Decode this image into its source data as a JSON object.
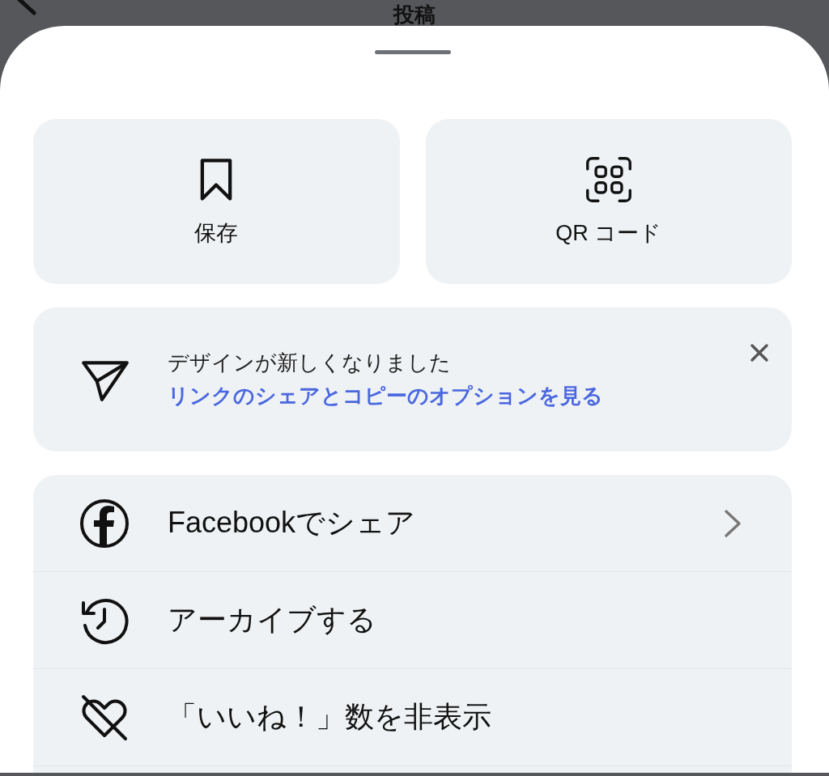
{
  "header": {
    "title": "投稿"
  },
  "actions": [
    {
      "kind": "save",
      "label": "保存"
    },
    {
      "kind": "qr",
      "label": "QR コード"
    }
  ],
  "notice": {
    "title": "デザインが新しくなりました",
    "link": "リンクのシェアとコピーのオプションを見る"
  },
  "menu": [
    {
      "kind": "facebook",
      "label": "Facebookでシェア",
      "chevron": true
    },
    {
      "kind": "archive",
      "label": "アーカイブする",
      "chevron": false
    },
    {
      "kind": "hide-likes",
      "label": "「いいね！」数を非表示",
      "chevron": false
    }
  ]
}
